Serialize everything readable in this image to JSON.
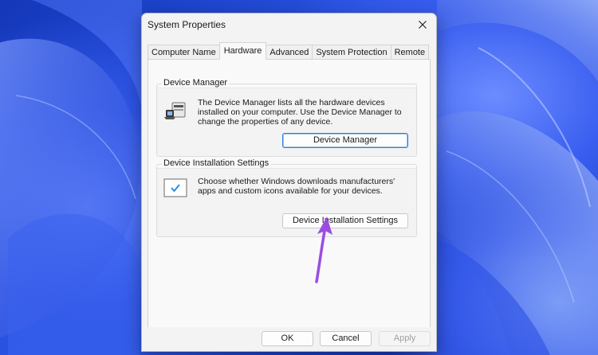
{
  "window": {
    "title": "System Properties"
  },
  "tabs": [
    {
      "label": "Computer Name"
    },
    {
      "label": "Hardware",
      "active": true
    },
    {
      "label": "Advanced"
    },
    {
      "label": "System Protection"
    },
    {
      "label": "Remote"
    }
  ],
  "device_manager": {
    "group_label": "Device Manager",
    "description": "The Device Manager lists all the hardware devices installed on your computer. Use the Device Manager to change the properties of any device.",
    "button_label": "Device Manager"
  },
  "device_installation": {
    "group_label": "Device Installation Settings",
    "description": "Choose whether Windows downloads manufacturers' apps and custom icons available for your devices.",
    "button_label": "Device Installation Settings"
  },
  "footer": {
    "ok_label": "OK",
    "cancel_label": "Cancel",
    "apply_label": "Apply"
  },
  "icons": {
    "close": "close-icon",
    "device_manager": "device-manager-icon",
    "installation_settings": "installation-settings-icon",
    "annotation_arrow": "arrow-icon"
  },
  "colors": {
    "accent": "#2a7fd4",
    "annotation_arrow": "#9b4de0",
    "wallpaper": "#1f45c8"
  }
}
